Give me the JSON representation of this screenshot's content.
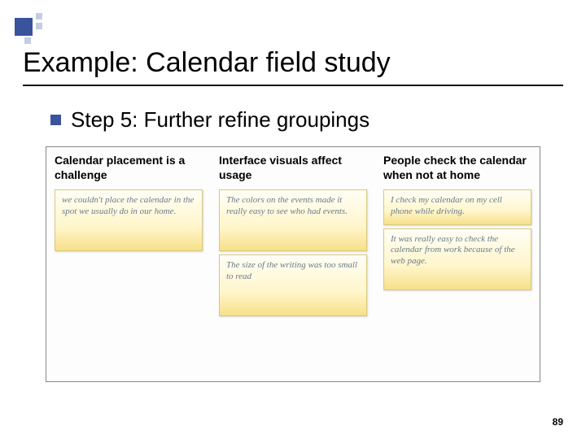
{
  "title": "Example: Calendar field study",
  "step": "Step 5: Further refine groupings",
  "columns": [
    {
      "heading": "Calendar placement is a challenge",
      "notes": [
        "we couldn't place the calendar in the spot we usually do in our home."
      ]
    },
    {
      "heading": "Interface visuals affect usage",
      "notes": [
        "The colors on the events made it really easy to see who had events.",
        "The size of the writing was too small to read"
      ]
    },
    {
      "heading": "People check the calendar when not at home",
      "notes": [
        "I check my calendar on my cell phone while driving.",
        "It was really easy to check the calendar from work because of the web page."
      ]
    }
  ],
  "page_number": "89"
}
